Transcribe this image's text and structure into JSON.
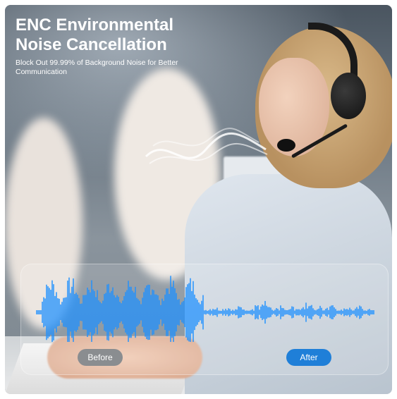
{
  "headline": {
    "line1": "ENC Environmental",
    "line2": "Noise Cancellation"
  },
  "subheadline": "Block Out 99.99% of Background Noise for Better Communication",
  "comparison": {
    "before_label": "Before",
    "after_label": "After"
  },
  "colors": {
    "wave": "#1e90ff",
    "after_pill": "#1f7fd8",
    "before_pill": "#8a8d90"
  }
}
